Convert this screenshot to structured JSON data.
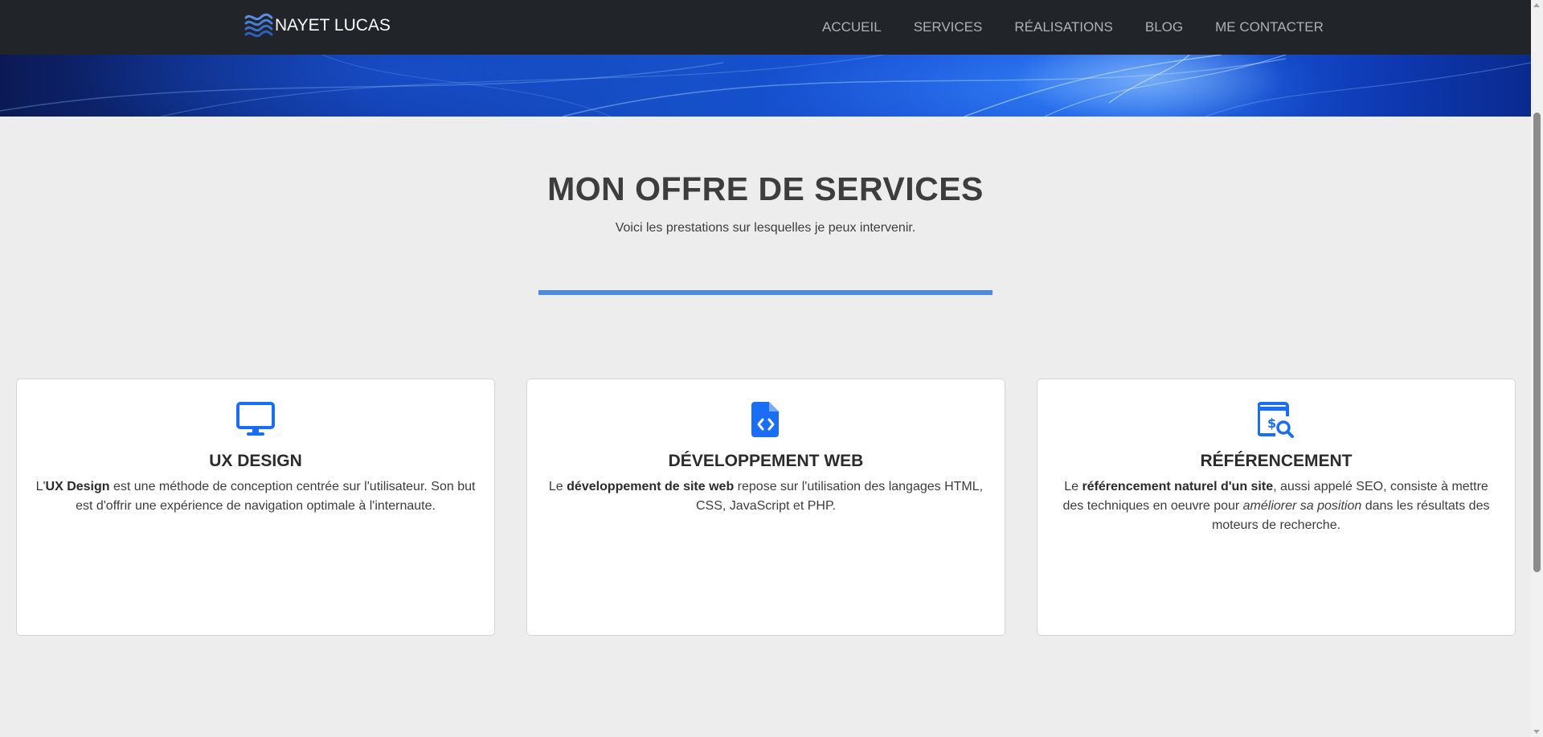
{
  "navbar": {
    "brand": "NAYET LUCAS",
    "brand_icon": "waves-logo-icon",
    "links": [
      "ACCUEIL",
      "SERVICES",
      "RÉALISATIONS",
      "BLOG",
      "ME CONTACTER"
    ]
  },
  "section": {
    "title": "MON OFFRE DE SERVICES",
    "subtitle": "Voici les prestations sur lesquelles je peux intervenir."
  },
  "cards": [
    {
      "icon": "monitor-icon",
      "title": "UX DESIGN",
      "text_parts": [
        "L'",
        "UX Design",
        " est une méthode de conception centrée sur l'utilisateur. Son but est d'offrir une expérience de navigation optimale à l'internaute."
      ]
    },
    {
      "icon": "code-file-icon",
      "title": "DÉVELOPPEMENT WEB",
      "text_parts": [
        "Le ",
        "développement de site web",
        " repose sur l'utilisation des langages HTML, CSS, JavaScript et PHP."
      ]
    },
    {
      "icon": "search-seo-icon",
      "title": "RÉFÉRENCEMENT",
      "text_parts": [
        "Le ",
        "référencement naturel d'un site",
        ", aussi appelé SEO, consiste à mettre des techniques en oeuvre pour ",
        "améliorer sa position",
        " dans les résultats des moteurs de recherche."
      ]
    }
  ],
  "colors": {
    "navbar_bg": "#212529",
    "accent": "#4a8ae8",
    "icon_blue": "#1a6ef5",
    "page_bg": "#ededed"
  }
}
